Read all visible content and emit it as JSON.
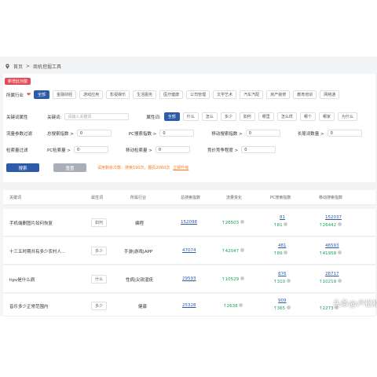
{
  "breadcrumb": {
    "home": "首页",
    "sep": ">",
    "current": "商机挖掘工具"
  },
  "new_badge": "新增此功能",
  "industry": {
    "label": "所属行业",
    "options": [
      "全部",
      "金融财经",
      "游戏应用",
      "影视娱乐",
      "生活服务",
      "医疗健康",
      "公司管理",
      "文学艺术",
      "汽车汽配",
      "房产装修",
      "教育培训",
      "网络通"
    ]
  },
  "keyword_filter": {
    "label": "关键词属性",
    "input_label": "关键词:",
    "input_placeholder": "请输入关键词",
    "attr_label": "属性词:",
    "attr_options": [
      "全部",
      "什么",
      "怎么",
      "多少",
      "如何",
      "哪里",
      "怎么样",
      "哪个",
      "哪家",
      "为什么"
    ]
  },
  "traffic": {
    "label": "流量参数过滤",
    "fields": [
      {
        "label": "总搜索指数 >",
        "value": "0"
      },
      {
        "label": "PC搜索指数 >",
        "value": "0"
      },
      {
        "label": "移动搜索指数 >",
        "value": "0"
      },
      {
        "label": "长尾词数量 >",
        "value": "0"
      }
    ]
  },
  "search_volume": {
    "label": "检索量过滤",
    "fields": [
      {
        "label": "PC检索量 >",
        "value": "0"
      },
      {
        "label": "移动检索量 >",
        "value": "0"
      },
      {
        "label": "竞价竞争程度 >",
        "value": "0"
      }
    ]
  },
  "actions": {
    "search": "搜索",
    "reset": "重置",
    "trial_hint": "试用剩余次数：搜索190次，翻页2060次",
    "upgrade": "立即升级"
  },
  "table": {
    "headers": [
      "关键词",
      "属性词",
      "所属行业",
      "总搜索指数",
      "流量变化",
      "PC搜索指数",
      "移动搜索指数"
    ],
    "rows": [
      {
        "keyword": "手机端删图片如何恢复",
        "attr": "如何",
        "industry": "编程",
        "total": "152098",
        "change": "26503",
        "pc": "81",
        "pc_change": "81",
        "mobile": "152037",
        "mobile_change": "26442"
      },
      {
        "keyword": "十三五时期共有多少农村人...",
        "attr": "多少",
        "industry": "手游|游戏|APP",
        "total": "47074",
        "change": "42047",
        "pc": "481",
        "pc_change": "89",
        "mobile": "46593",
        "mobile_change": "41958"
      },
      {
        "keyword": "hpv是什么病",
        "attr": "什么",
        "industry": "性病|尖锐湿疣",
        "total": "29593",
        "change": "10529",
        "pc": "876",
        "pc_change": "310",
        "mobile": "28717",
        "mobile_change": "10219"
      },
      {
        "keyword": "音乐多少正常范围内",
        "attr": "多少",
        "industry": "健康",
        "total": "25328",
        "change": "2638",
        "pc": "909",
        "pc_change": "365",
        "mobile": "",
        "mobile_change": "2273"
      }
    ]
  },
  "watermark": "头条@卢松松",
  "colors": {
    "primary": "#2d5ba8",
    "badge": "#e34d59",
    "hint": "#ff7a1a",
    "up": "#18a058"
  }
}
